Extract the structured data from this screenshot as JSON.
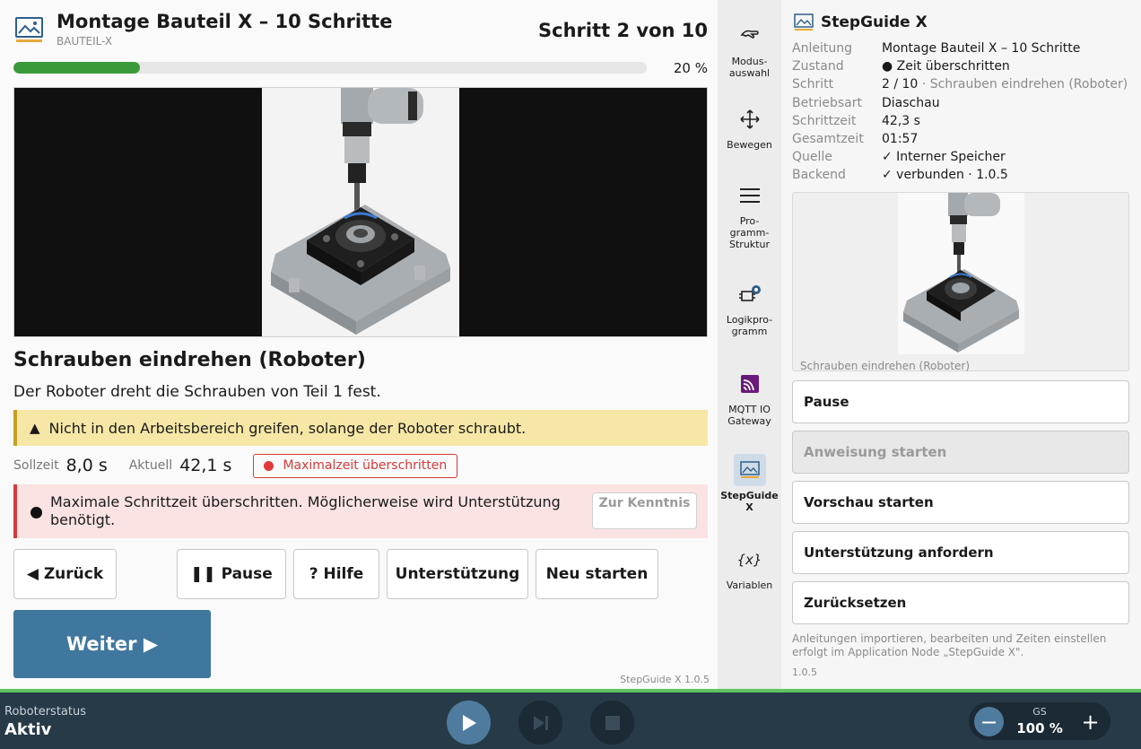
{
  "header": {
    "title": "Montage Bauteil X – 10 Schritte",
    "subtitle": "BAUTEIL-X",
    "step_counter": "Schritt 2 von 10",
    "progress_fraction": 0.2,
    "progress_label": "20 %"
  },
  "step": {
    "title": "Schrauben eindrehen (Roboter)",
    "description": "Der Roboter dreht die Schrauben von Teil 1 fest.",
    "warning_symbol": "▲",
    "warning": "Nicht in den Arbeitsbereich greifen, solange der Roboter schraubt.",
    "target_label": "Sollzeit",
    "target_value": "8,0 s",
    "actual_label": "Aktuell",
    "actual_value": "42,1 s",
    "time_badge": "Maximalzeit überschritten",
    "alert": "Maximale Schrittzeit überschritten. Möglicherweise wird Unterstützung benötigt.",
    "ack_button": "Zur Kenntnis"
  },
  "buttons": {
    "back": "◀ Zurück",
    "pause": "❚❚ Pause",
    "help": "? Hilfe",
    "support": "Unterstützung",
    "restart": "Neu starten",
    "next": "Weiter ▶"
  },
  "version_main": "StepGuide X 1.0.5",
  "nav": [
    {
      "label": "Modus-\nauswahl"
    },
    {
      "label": "Bewegen"
    },
    {
      "label": "Pro-\ngramm-\nStruktur"
    },
    {
      "label": "Logikpro-\ngramm"
    },
    {
      "label": "MQTT IO\nGateway"
    },
    {
      "label": "StepGuide\nX"
    },
    {
      "label": "Variablen"
    }
  ],
  "side": {
    "title": "StepGuide X",
    "info": [
      {
        "k": "Anleitung",
        "v": "Montage Bauteil X – 10 Schritte"
      },
      {
        "k": "Zustand",
        "v": "● Zeit überschritten"
      },
      {
        "k": "Schritt",
        "v": "2 / 10",
        "extra": "· Schrauben eindrehen (Roboter)"
      },
      {
        "k": "Betriebsart",
        "v": "Diaschau"
      },
      {
        "k": "Schrittzeit",
        "v": "42,3 s"
      },
      {
        "k": "Gesamtzeit",
        "v": "01:57"
      },
      {
        "k": "Quelle",
        "v": "✓ Interner Speicher"
      },
      {
        "k": "Backend",
        "v": "✓ verbunden · 1.0.5"
      }
    ],
    "preview_caption": "Schrauben eindrehen (Roboter)",
    "buttons": {
      "pause": "Pause",
      "start_instruction": "Anweisung starten",
      "start_preview": "Vorschau starten",
      "request_support": "Unterstützung anfordern",
      "reset": "Zurücksetzen"
    },
    "note": "Anleitungen importieren, bearbeiten und Zeiten einstellen erfolgt im Application Node „StepGuide X\".",
    "version": "1.0.5"
  },
  "statusbar": {
    "label": "Roboterstatus",
    "value": "Aktiv",
    "speed_label": "GS",
    "speed_value": "100 %"
  },
  "colors": {
    "accent": "#40779e",
    "progress": "#3a9a3a",
    "warning_bg": "#f7e7a6",
    "alert_bg": "#fbe3e3",
    "error": "#d23b3b",
    "statusbar": "#263a48",
    "status_ok": "#5fc45f"
  }
}
